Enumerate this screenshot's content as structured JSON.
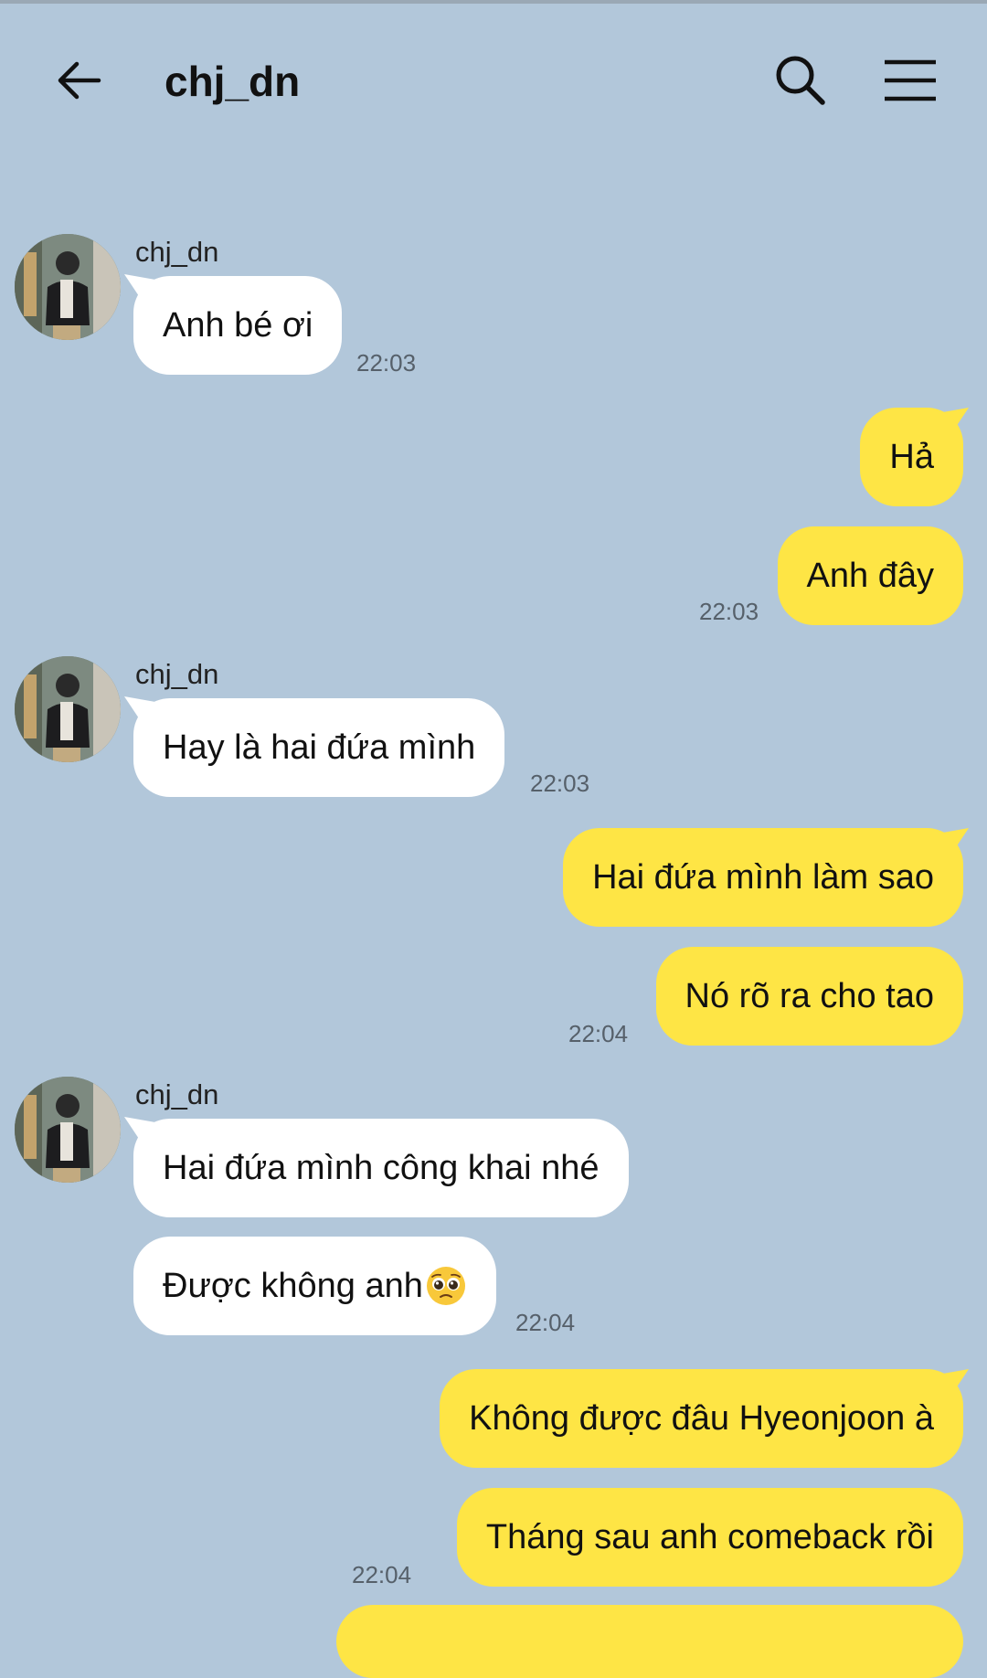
{
  "header": {
    "title": "chj_dn",
    "back_icon": "arrow-left-icon",
    "search_icon": "search-icon",
    "menu_icon": "menu-icon"
  },
  "colors": {
    "background": "#b2c7da",
    "incoming_bubble": "#ffffff",
    "outgoing_bubble": "#fee545"
  },
  "messages": [
    {
      "sender": "chj_dn",
      "text": "Anh bé ơi",
      "time": "22:03"
    },
    {
      "text": "Hả"
    },
    {
      "text": "Anh đây",
      "time": "22:03"
    },
    {
      "sender": "chj_dn",
      "text": "Hay là hai đứa mình",
      "time": "22:03"
    },
    {
      "text": "Hai đứa mình làm sao"
    },
    {
      "text": "Nó rõ ra cho tao",
      "time": "22:04"
    },
    {
      "sender": "chj_dn",
      "text": "Hai đứa mình công khai nhé"
    },
    {
      "text": "Được không anh",
      "emoji": "pleading-face-icon",
      "time": "22:04"
    },
    {
      "text": "Không được đâu Hyeonjoon à"
    },
    {
      "text": "Tháng sau anh comeback rồi",
      "time": "22:04"
    }
  ]
}
